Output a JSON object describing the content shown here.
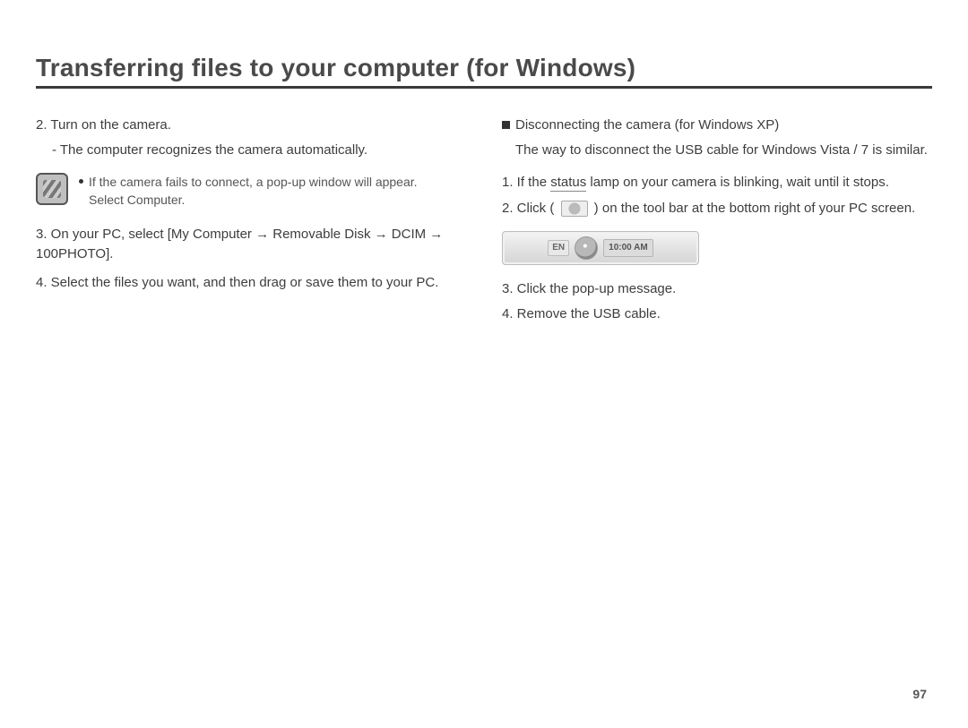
{
  "title": "Transferring files to your computer (for Windows)",
  "page_number": "97",
  "left": {
    "step2": "2. Turn on the camera.",
    "step2_sub": "- The computer recognizes the camera automatically.",
    "note_line1": "If the camera fails to connect, a pop-up window will appear.",
    "note_line2": "Select Computer.",
    "step3": "3. On your PC, select [My Computer → Removable Disk → DCIM → 100PHOTO].",
    "step4": "4. Select the files you want, and then drag or save them to your PC."
  },
  "right": {
    "heading": "Disconnecting the camera (for Windows XP)",
    "heading_sub": "The way to disconnect the USB cable for Windows Vista / 7 is similar.",
    "step1_a": "1. If the ",
    "step1_status": "status",
    "step1_b": " lamp on your camera is blinking, wait until it stops.",
    "step2_a": "2. Click ( ",
    "step2_b": " ) on the tool bar at the bottom right of your PC screen.",
    "tray_lang": "EN",
    "tray_clock": "10:00 AM",
    "step3": "3. Click the pop-up message.",
    "step4": "4. Remove the USB cable."
  }
}
